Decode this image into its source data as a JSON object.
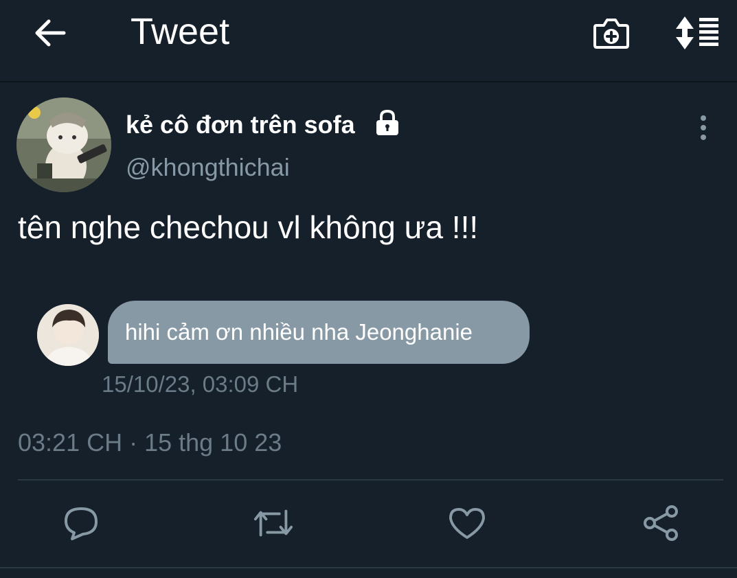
{
  "header": {
    "title": "Tweet",
    "icons": {
      "back": "arrow-left-icon",
      "camera": "camera-add-icon",
      "sort": "sort-list-icon"
    }
  },
  "tweet": {
    "display_name": "kẻ cô đơn trên sofa",
    "handle": "@khongthichai",
    "protected": true,
    "text": "tên nghe chechou vl không ưa !!!",
    "timestamp": "03:21 CH · 15 thg 10 23"
  },
  "embedded_message": {
    "text": "hihi cảm ơn nhiều nha Jeonghanie",
    "time": "15/10/23, 03:09 CH"
  },
  "actions": [
    "reply-icon",
    "retweet-icon",
    "like-icon",
    "share-icon"
  ],
  "colors": {
    "background": "#15202b",
    "secondary_text": "#8899a6",
    "bubble": "#8899a6",
    "divider": "#2b3945"
  }
}
